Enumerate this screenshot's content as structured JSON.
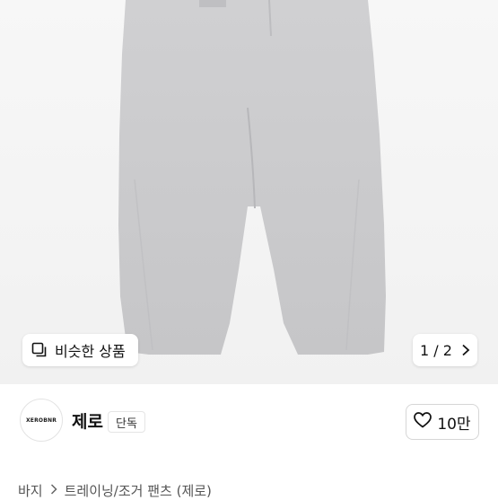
{
  "hero": {
    "product_image": "gray-sweatpants-photo",
    "similar_button": {
      "label": "비슷한 상품",
      "icon": "similar-items-icon"
    },
    "pager": {
      "text": "1 / 2",
      "icon": "chevron-right-icon"
    }
  },
  "store": {
    "logo_text": "XEROBNR",
    "name": "제로",
    "badge": "단독",
    "like": {
      "icon": "heart-outline-icon",
      "count": "10만"
    }
  },
  "breadcrumb": {
    "items": [
      "바지",
      "트레이닝/조거 팬츠 (제로)"
    ],
    "separator_icon": "chevron-right-icon"
  },
  "colors": {
    "pants": "#c9c9cb",
    "background": "#f3f3f3",
    "text": "#111111"
  }
}
